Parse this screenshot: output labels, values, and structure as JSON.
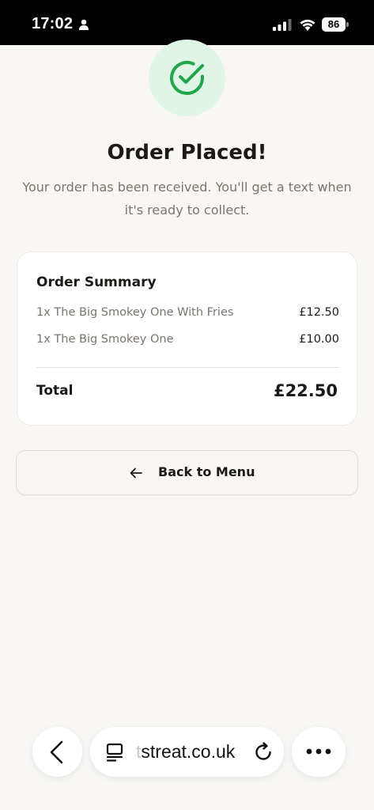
{
  "status_bar": {
    "time": "17:02",
    "battery": "86",
    "icons": [
      "person-icon",
      "signal-icon",
      "wifi-icon",
      "battery-icon"
    ]
  },
  "confirmation": {
    "icon": "check-circle-icon",
    "title": "Order Placed!",
    "subtitle": "Your order has been received. You'll get a text when it's ready to collect."
  },
  "summary": {
    "title": "Order Summary",
    "items": [
      {
        "name": "1x The Big Smokey One With Fries",
        "price": "£12.50"
      },
      {
        "name": "1x The Big Smokey One",
        "price": "£10.00"
      }
    ],
    "total_label": "Total",
    "total_value": "£22.50"
  },
  "back_button": {
    "icon": "arrow-left-icon",
    "label": "Back to Menu"
  },
  "browser": {
    "url_faded": "t",
    "url_main": "streat.co.uk",
    "icons": [
      "chevron-left-icon",
      "tabs-icon",
      "reload-icon",
      "more-icon"
    ]
  },
  "colors": {
    "background": "#f8f7f4",
    "accent_green": "#21a64b",
    "success_bg": "#dff5e6",
    "text_primary": "#1c1a17",
    "text_muted": "#7a756d"
  }
}
